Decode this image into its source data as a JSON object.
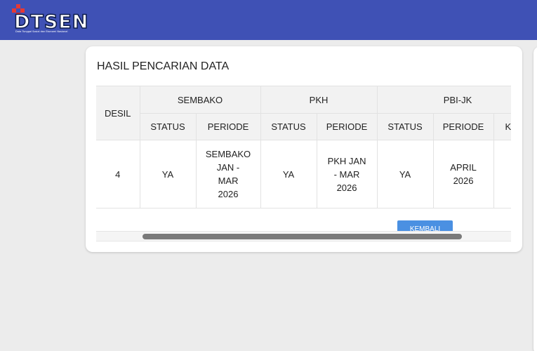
{
  "header": {
    "logo_text": "DTSEN",
    "logo_subtitle": "Data Tunggal Sosial dan Ekonomi Nasional",
    "background_color": "#3f51b5"
  },
  "card": {
    "title": "HASIL PENCARIAN DATA",
    "back_button_label": "KEMBALI"
  },
  "table": {
    "desil_header": "DESIL",
    "groups": [
      "SEMBAKO",
      "PKH",
      "PBI-JK"
    ],
    "sub_headers": [
      "STATUS",
      "PERIODE",
      "STATUS",
      "PERIODE",
      "STATUS",
      "PERIODE",
      "KI"
    ],
    "row": {
      "desil": "4",
      "sembako_status": "YA",
      "sembako_periode": [
        "SEMBAKO",
        "JAN -",
        "MAR",
        "2026"
      ],
      "pkh_status": "YA",
      "pkh_periode": [
        "PKH JAN",
        "- MAR",
        "2026"
      ],
      "pbijk_status": "YA",
      "pbijk_periode": [
        "APRIL",
        "2026"
      ],
      "extra": ""
    }
  },
  "colors": {
    "accent": "#3f51b5",
    "button": "#4a90e2",
    "page_background": "#ececec"
  }
}
